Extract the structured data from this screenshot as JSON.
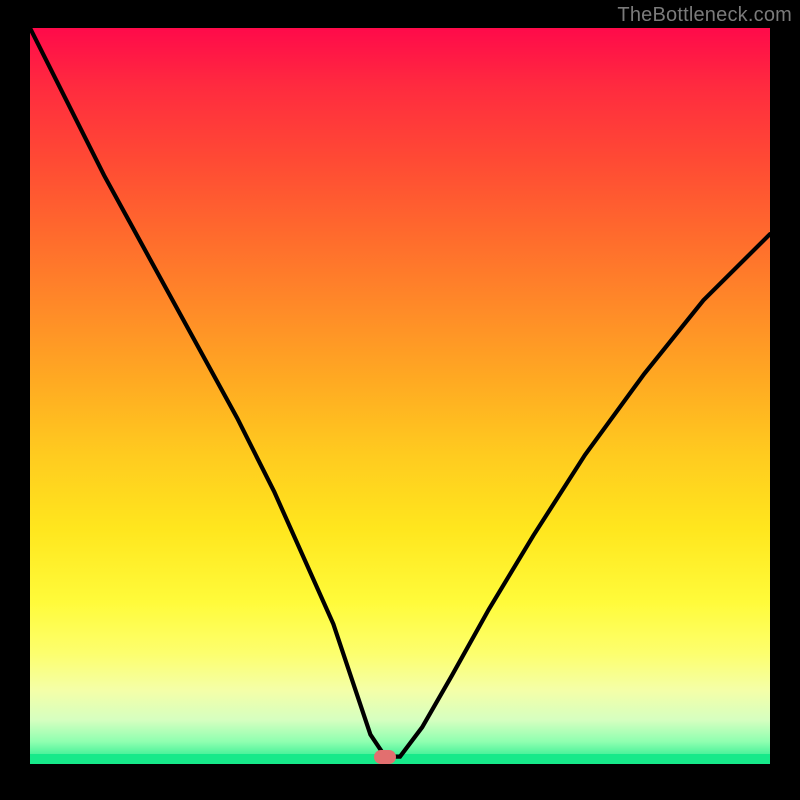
{
  "watermark": "TheBottleneck.com",
  "marker": {
    "x_frac": 0.48,
    "y_frac": 0.99
  },
  "chart_data": {
    "type": "line",
    "title": "",
    "xlabel": "",
    "ylabel": "",
    "xlim": [
      0,
      1
    ],
    "ylim": [
      0,
      1
    ],
    "x": [
      0.0,
      0.05,
      0.1,
      0.16,
      0.22,
      0.28,
      0.33,
      0.37,
      0.41,
      0.44,
      0.46,
      0.48,
      0.5,
      0.53,
      0.57,
      0.62,
      0.68,
      0.75,
      0.83,
      0.91,
      1.0
    ],
    "values": [
      1.0,
      0.9,
      0.8,
      0.69,
      0.58,
      0.47,
      0.37,
      0.28,
      0.19,
      0.1,
      0.04,
      0.01,
      0.01,
      0.05,
      0.12,
      0.21,
      0.31,
      0.42,
      0.53,
      0.63,
      0.72
    ],
    "series": [
      {
        "name": "bottleneck-curve",
        "x": [
          0.0,
          0.05,
          0.1,
          0.16,
          0.22,
          0.28,
          0.33,
          0.37,
          0.41,
          0.44,
          0.46,
          0.48,
          0.5,
          0.53,
          0.57,
          0.62,
          0.68,
          0.75,
          0.83,
          0.91,
          1.0
        ],
        "values": [
          1.0,
          0.9,
          0.8,
          0.69,
          0.58,
          0.47,
          0.37,
          0.28,
          0.19,
          0.1,
          0.04,
          0.01,
          0.01,
          0.05,
          0.12,
          0.21,
          0.31,
          0.42,
          0.53,
          0.63,
          0.72
        ]
      }
    ],
    "gradient_stops": [
      {
        "pos": 0.0,
        "color": "#ff0a4a"
      },
      {
        "pos": 0.5,
        "color": "#ffcb1f"
      },
      {
        "pos": 0.8,
        "color": "#fffb3a"
      },
      {
        "pos": 1.0,
        "color": "#17e98a"
      }
    ]
  }
}
